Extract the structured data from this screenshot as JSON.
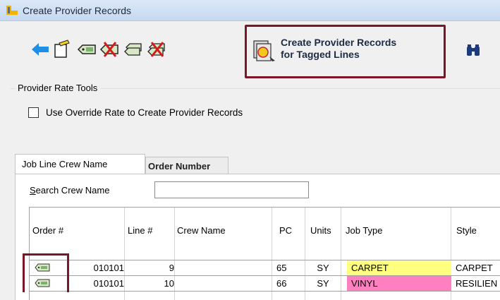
{
  "window": {
    "title": "Create Provider Records"
  },
  "toolbar": {
    "create_label_line1": "Create Provider Records",
    "create_label_line2": "for Tagged Lines"
  },
  "rate_tools": {
    "group_label": "Provider Rate Tools",
    "override_checkbox_label": "Use Override Rate to Create Provider Records",
    "override_checked": false
  },
  "tabs": [
    {
      "label": "Job Line Crew Name",
      "active": true
    },
    {
      "label": "Order Number",
      "active": false
    }
  ],
  "search": {
    "label": "Search Crew Name",
    "value": ""
  },
  "grid": {
    "columns": [
      "Order #",
      "Line #",
      "Crew Name",
      "PC",
      "Units",
      "Job Type",
      "Style"
    ],
    "rows": [
      {
        "order": "010101",
        "line": "9",
        "crew": "",
        "pc": "65",
        "units": "SY",
        "job_type": "CARPET",
        "job_type_color": "#ffff80",
        "style": "CARPET"
      },
      {
        "order": "010101",
        "line": "10",
        "crew": "",
        "pc": "66",
        "units": "SY",
        "job_type": "VINYL",
        "job_type_color": "#ff80c0",
        "style": "RESILIEN"
      }
    ]
  },
  "colors": {
    "highlight_border": "#7a1628",
    "title_bar": "#c6d9f1"
  }
}
